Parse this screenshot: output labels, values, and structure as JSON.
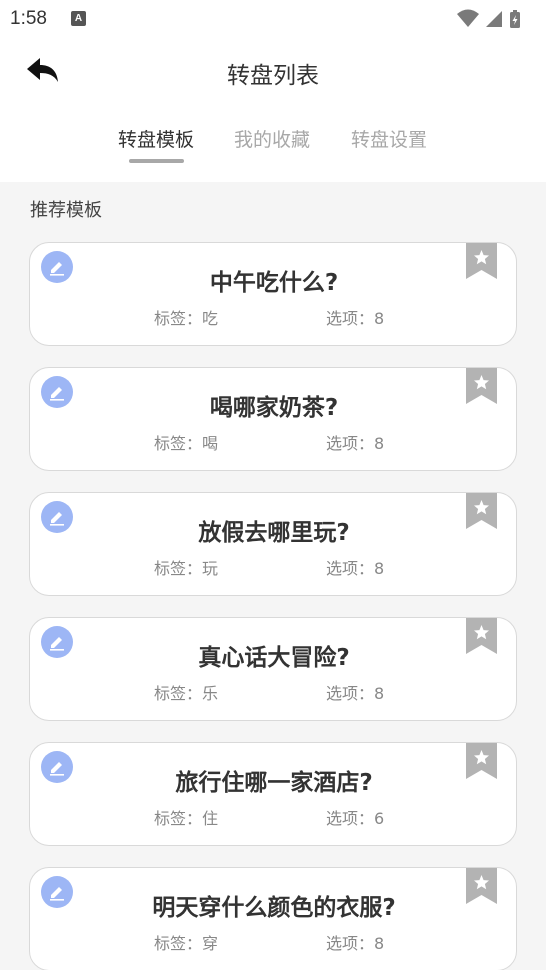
{
  "status_bar": {
    "time": "1:58",
    "app_icon_letter": "A"
  },
  "header": {
    "title": "转盘列表",
    "tabs": [
      {
        "label": "转盘模板",
        "active": true
      },
      {
        "label": "我的收藏",
        "active": false
      },
      {
        "label": "转盘设置",
        "active": false
      }
    ]
  },
  "section": {
    "title": "推荐模板"
  },
  "colors": {
    "edit_icon_bg": "#9db6f5",
    "bookmark": "#b3b3b3",
    "card_border": "#d9d9d9",
    "page_bg": "#f5f5f5"
  },
  "cards": [
    {
      "title": "中午吃什么?",
      "tag": "标签：吃",
      "options": "选项：8"
    },
    {
      "title": "喝哪家奶茶?",
      "tag": "标签：喝",
      "options": "选项：8"
    },
    {
      "title": "放假去哪里玩?",
      "tag": "标签：玩",
      "options": "选项：8"
    },
    {
      "title": "真心话大冒险?",
      "tag": "标签：乐",
      "options": "选项：8"
    },
    {
      "title": "旅行住哪一家酒店?",
      "tag": "标签：住",
      "options": "选项：6"
    },
    {
      "title": "明天穿什么颜色的衣服?",
      "tag": "标签：穿",
      "options": "选项：8"
    }
  ]
}
